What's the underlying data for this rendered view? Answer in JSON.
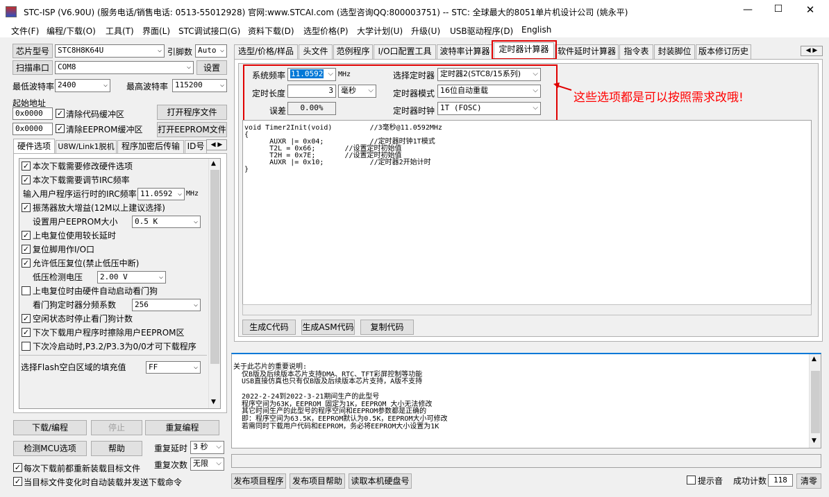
{
  "window": {
    "title": "STC-ISP (V6.90U) (服务电话/销售电话: 0513-55012928) 官网:www.STCAI.com  (选型咨询QQ:800003751) -- STC: 全球最大的8051单片机设计公司 (姚永平)",
    "min": "—",
    "max": "☐",
    "close": "✕"
  },
  "menu": [
    "文件(F)",
    "编程/下载(O)",
    "工具(T)",
    "界面(L)",
    "STC调试接口(G)",
    "资料下载(D)",
    "选型价格(P)",
    "大学计划(U)",
    "升级(U)",
    "USB驱动程序(D)",
    "English"
  ],
  "left": {
    "chip_type_btn": "芯片型号",
    "chip_type": "STC8H8K64U",
    "pins_label": "引脚数",
    "pins": "Auto",
    "scan_btn": "扫描串口",
    "port": "COM8",
    "settings_btn": "设置",
    "min_baud_label": "最低波特率",
    "min_baud": "2400",
    "max_baud_label": "最高波特率",
    "max_baud": "115200",
    "start_addr_label": "起始地址",
    "addr1": "0x0000",
    "clear_code": "清除代码缓冲区",
    "open_prog_btn": "打开程序文件",
    "addr2": "0x0000",
    "clear_eeprom": "清除EEPROM缓冲区",
    "open_eeprom_btn": "打开EEPROM文件",
    "tabs": [
      "硬件选项",
      "U8W/Link1脱机",
      "程序加密后传输",
      "ID号"
    ],
    "options": [
      {
        "text": "本次下载需要修改硬件选项",
        "checked": true
      },
      {
        "text": "本次下载需要调节IRC频率",
        "checked": true
      }
    ],
    "irc_label": "输入用户程序运行时的IRC频率",
    "irc_value": "11.0592",
    "irc_unit": "MHz",
    "amp_gain": "振荡器放大增益(12M以上建议选择)",
    "eeprom_size_label": "设置用户EEPROM大小",
    "eeprom_size": "0.5 K",
    "long_reset": "上电复位使用较长延时",
    "reset_io": "复位脚用作I/O口",
    "low_volt_reset": "允许低压复位(禁止低压中断)",
    "low_volt_label": "低压检测电压",
    "low_volt": "2.00 V",
    "auto_wdt": "上电复位时由硬件自动启动看门狗",
    "wdt_div_label": "看门狗定时器分频系数",
    "wdt_div": "256",
    "idle_stop_wdt": "空闲状态时停止看门狗计数",
    "erase_eeprom": "下次下载用户程序时擦除用户EEPROM区",
    "cold_boot": "下次冷启动时,P3.2/P3.3为0/0才可下载程序",
    "flash_fill_label": "选择Flash空白区域的填充值",
    "flash_fill": "FF",
    "download_btn": "下载/编程",
    "stop_btn": "停止",
    "reprogram_btn": "重复编程",
    "detect_btn": "检测MCU选项",
    "help_btn": "帮助",
    "repeat_delay_label": "重复延时",
    "repeat_delay": "3 秒",
    "repeat_count_label": "重复次数",
    "repeat_count": "无限",
    "reload_each": "每次下载前都重新装载目标文件",
    "auto_send": "当目标文件变化时自动装载并发送下载命令"
  },
  "tabs": [
    "选型/价格/样品",
    "头文件",
    "范例程序",
    "I/O口配置工具",
    "波特率计算器",
    "定时器计算器",
    "软件延时计算器",
    "指令表",
    "封装脚位",
    "版本修订历史"
  ],
  "timer": {
    "sys_freq_label": "系统频率",
    "sys_freq": "11.0592",
    "sys_freq_unit": "MHz",
    "select_timer_label": "选择定时器",
    "select_timer": "定时器2(STC8/15系列)",
    "length_label": "定时长度",
    "length": "3",
    "length_unit": "毫秒",
    "mode_label": "定时器模式",
    "mode": "16位自动重载",
    "error_label": "误差",
    "error": "0.00%",
    "clock_label": "定时器时钟",
    "clock": "1T  (FOSC)",
    "code": "void Timer2Init(void)\t\t//3毫秒@11.0592MHz\n{\n\tAUXR |= 0x04;\t\t//定时器时钟1T模式\n\tT2L = 0x66;\t\t//设置定时初始值\n\tT2H = 0x7E;\t\t//设置定时初始值\n\tAUXR |= 0x10;\t\t//定时器2开始计时\n}",
    "gen_c_btn": "生成C代码",
    "gen_asm_btn": "生成ASM代码",
    "copy_btn": "复制代码"
  },
  "annotation": "这些选项都是可以按照需求改哦!",
  "colors": {
    "annotation": "#ff0000",
    "selection": "#0078d7",
    "box": "#e00000"
  },
  "info": "关于此芯片的重要说明:\n  仅B版及后续版本芯片支持DMA、RTC、TFT彩屏控制等功能\n  USB直接仿真也只有仅B版及后续版本芯片支持，A版不支持\n\n  2022-2-24到2022-3-21期间生产的此型号\n  程序空间为63K，EEPROM 固定为1K，EEPROM 大小无法修改\n  其它时间生产的此型号的程序空间和EEPROM参数都是正确的\n  即：程序空间为63.5K，EEPROM默认为0.5K，EEPROM大小可修改\n  若需同时下载用户代码和EEPROM，务必将EEPROM大小设置为1K",
  "bottom": {
    "publish_prog": "发布项目程序",
    "publish_help": "发布项目帮助",
    "read_disk": "读取本机硬盘号",
    "sound": "提示音",
    "success_label": "成功计数",
    "success_count": "118",
    "clear_btn": "清零"
  }
}
